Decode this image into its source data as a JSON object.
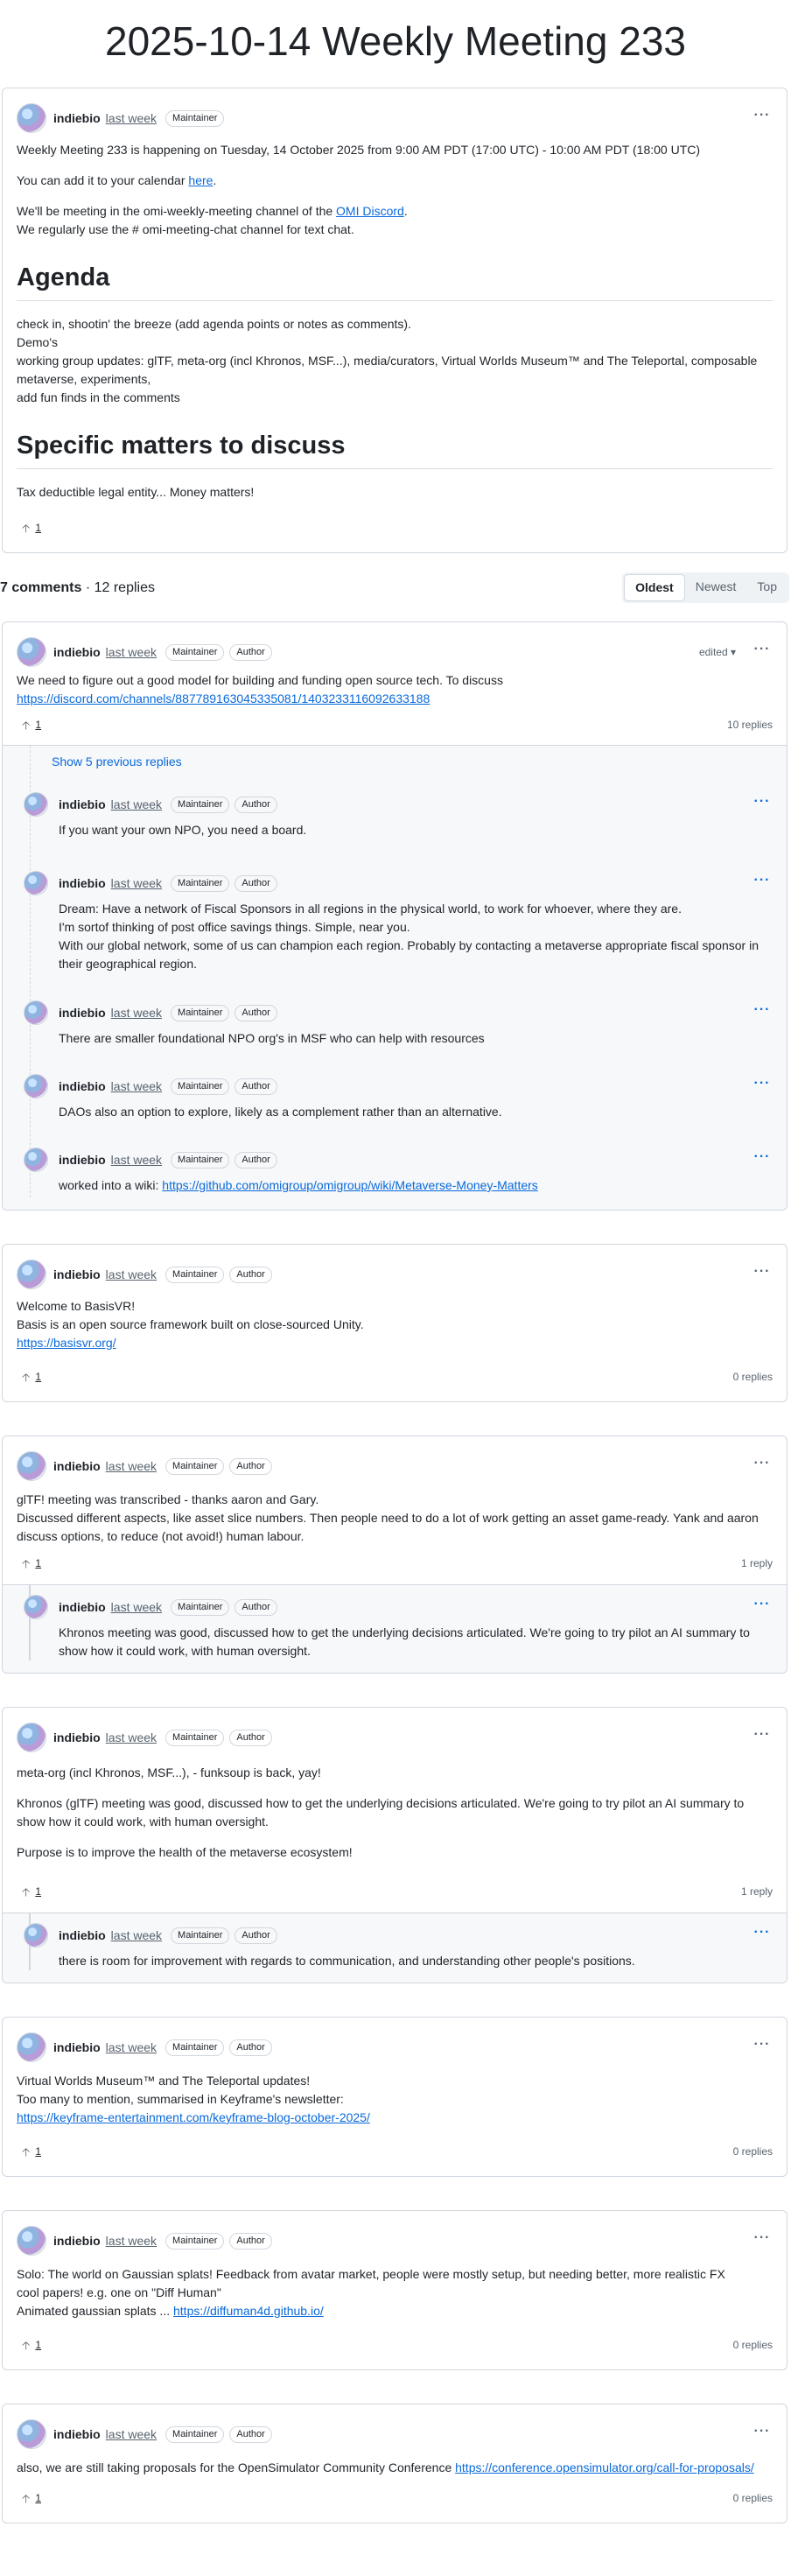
{
  "page": {
    "title": "2025-10-14 Weekly Meeting 233"
  },
  "labels": {
    "maintainer": "Maintainer",
    "author": "Author",
    "more": "···",
    "upvote": "🡡",
    "edited": "edited ▾",
    "show_previous": "Show 5 previous replies"
  },
  "post": {
    "author": "indiebio",
    "time": "last week",
    "p1": "Weekly Meeting 233 is happening on Tuesday, 14 October 2025 from 9:00 AM PDT (17:00 UTC) - 10:00 AM PDT (18:00 UTC)",
    "p2_pre": "You can add it to your calendar ",
    "p2_link": "here",
    "p2_post": ".",
    "p3_pre": "We'll be meeting in the omi-weekly-meeting channel of the ",
    "p3_link": "OMI Discord",
    "p3_post": ".",
    "p4": "We regularly use the # omi-meeting-chat channel for text chat.",
    "agenda_heading": "Agenda",
    "agenda_lines": [
      "check in, shootin' the breeze (add agenda points or notes as comments).",
      "Demo's",
      "working group updates: glTF, meta-org (incl Khronos, MSF...), media/curators, Virtual Worlds Museum™ and The Teleportal, composable metaverse, experiments,",
      "add fun finds in the comments"
    ],
    "matters_heading": "Specific matters to discuss",
    "matters_text": "Tax deductible legal entity... Money matters!",
    "upvotes": "1"
  },
  "comments_bar": {
    "count": "7 comments",
    "sep": " · ",
    "replies": "12 replies",
    "sort_options": [
      "Oldest",
      "Newest",
      "Top"
    ]
  },
  "comments": [
    {
      "author": "indiebio",
      "time": "last week",
      "line1": "We need to figure out a good model for building and funding open source tech. To discuss",
      "link": "https://discord.com/channels/887789163045335081/1403233116092633188",
      "upvotes": "1",
      "replies": "10 replies",
      "thread": [
        {
          "author": "indiebio",
          "time": "last week",
          "lines": [
            "If you want your own NPO, you need a board."
          ]
        },
        {
          "author": "indiebio",
          "time": "last week",
          "lines": [
            "Dream: Have a network of Fiscal Sponsors in all regions in the physical world, to work for whoever, where they are.",
            "I'm sortof thinking of post office savings things. Simple, near you.",
            "With our global network, some of us can champion each region. Probably by contacting a metaverse appropriate fiscal sponsor in their geographical region."
          ]
        },
        {
          "author": "indiebio",
          "time": "last week",
          "lines": [
            "There are smaller foundational NPO org's in MSF who can help with resources"
          ]
        },
        {
          "author": "indiebio",
          "time": "last week",
          "lines": [
            "DAOs also an option to explore, likely as a complement rather than an alternative."
          ]
        },
        {
          "author": "indiebio",
          "time": "last week",
          "pre": "worked into a wiki: ",
          "link": "https://github.com/omigroup/omigroup/wiki/Metaverse-Money-Matters"
        }
      ]
    },
    {
      "author": "indiebio",
      "time": "last week",
      "line1": "Welcome to BasisVR!",
      "line2": "Basis is an open source framework built on close-sourced Unity.",
      "link": "https://basisvr.org/",
      "upvotes": "1",
      "replies": "0 replies"
    },
    {
      "author": "indiebio",
      "time": "last week",
      "line1": "glTF! meeting was transcribed - thanks aaron and Gary.",
      "line2": "Discussed different aspects, like asset slice numbers. Then people need to do a lot of work getting an asset game-ready. Yank and aaron discuss options, to reduce (not avoid!) human labour.",
      "upvotes": "1",
      "replies": "1 reply",
      "reply": {
        "author": "indiebio",
        "time": "last week",
        "text": "Khronos meeting was good, discussed how to get the underlying decisions articulated. We're going to try pilot an AI summary to show how it could work, with human oversight."
      }
    },
    {
      "author": "indiebio",
      "time": "last week",
      "p1": "meta-org (incl Khronos, MSF...), - funksoup is back, yay!",
      "p2": "Khronos (glTF) meeting was good, discussed how to get the underlying decisions articulated. We're going to try pilot an AI summary to show how it could work, with human oversight.",
      "p3": "Purpose is to improve the health of the metaverse ecosystem!",
      "upvotes": "1",
      "replies": "1 reply",
      "reply": {
        "author": "indiebio",
        "time": "last week",
        "text": "there is room for improvement with regards to communication, and understanding other people's positions."
      }
    },
    {
      "author": "indiebio",
      "time": "last week",
      "line1": "Virtual Worlds Museum™ and The Teleportal updates!",
      "line2": "Too many to mention, summarised in Keyframe's newsletter:",
      "link": "https://keyframe-entertainment.com/keyframe-blog-october-2025/",
      "upvotes": "1",
      "replies": "0 replies"
    },
    {
      "author": "indiebio",
      "time": "last week",
      "line1": "Solo: The world on Gaussian splats! Feedback from avatar market, people were mostly setup, but needing better, more realistic FX",
      "line2": "cool papers! e.g. one on \"Diff Human\"",
      "line3_pre": "Animated gaussian splats ... ",
      "link": "https://diffuman4d.github.io/",
      "upvotes": "1",
      "replies": "0 replies"
    },
    {
      "author": "indiebio",
      "time": "last week",
      "line1_pre": "also, we are still taking proposals for the OpenSimulator Community Conference ",
      "link": "https://conference.opensimulator.org/call-for-proposals/",
      "upvotes": "1",
      "replies": "0 replies"
    }
  ]
}
